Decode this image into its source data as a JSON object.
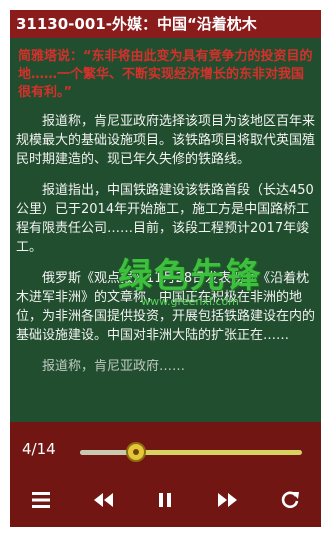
{
  "header": {
    "title": "31130-001-外媒：中国“沿着枕木"
  },
  "article": {
    "quote": "简雅塔说：“东非将由此变为具有竞争力的投资目的地……一个繁华、不断实现经济增长的东非对我国很有利。”",
    "paragraphs": [
      "报道称，肯尼亚政府选择该项目为该地区百年来规模最大的基础设施项目。该铁路项目将取代英国殖民时期建造的、现已年久失修的铁路线。",
      "报道指出，中国铁路建设该铁路首段（长达450公里）已于2014年开始施工，施工方是中国路桥工程有限责任公司……目前，该段工程预计2017年竣工。",
      "俄罗斯《观点报》11月28日发表题为《沿着枕木进军非洲》的文章称，中国正在积极在非洲的地位，为非洲各国提供投资，开展包括铁路建设在内的基础设施建设。中国对非洲大陆的扩张正在……",
      "报道称，肯尼亚政府……"
    ]
  },
  "watermark": {
    "big": "绿色先锋",
    "small": "www.greenxf.com"
  },
  "player": {
    "page_indicator": "4/14",
    "progress": 0.25,
    "controls": [
      "menu-icon",
      "rewind-icon",
      "pause-icon",
      "fast-forward-icon",
      "refresh-icon"
    ]
  },
  "colors": {
    "title_bar": "#8a1c1c",
    "background": "#214e2e",
    "quote": "#d6302c",
    "player": "#7a1414",
    "slider_track": "#d8d262",
    "slider_thumb": "#e8c63a",
    "watermark": "#3fbf3f"
  }
}
